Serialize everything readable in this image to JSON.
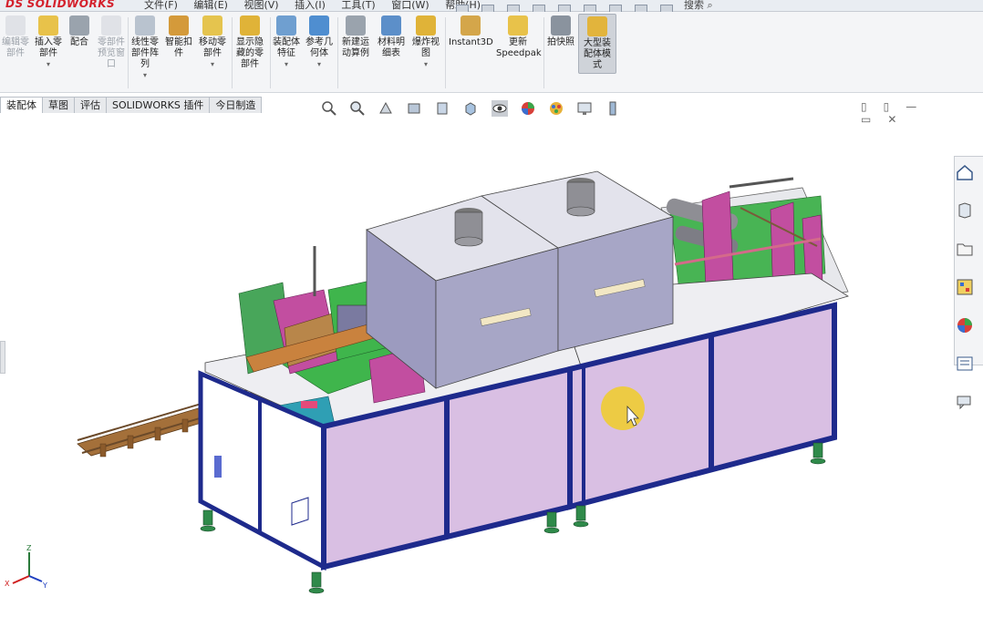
{
  "app": {
    "logo_prefix": "DS",
    "logo_text": "SOLIDWORKS"
  },
  "menu": [
    "文件(F)",
    "编辑(E)",
    "视图(V)",
    "插入(I)",
    "工具(T)",
    "窗口(W)",
    "帮助(H)"
  ],
  "search_label": "搜索",
  "ribbon": [
    {
      "label": "编辑零部件",
      "icon": "edit-component-icon",
      "enabled": false
    },
    {
      "label": "插入零部件",
      "icon": "insert-component-icon",
      "enabled": true,
      "caret": true
    },
    {
      "label": "配合",
      "icon": "mate-icon",
      "enabled": true
    },
    {
      "label": "零部件预览窗口",
      "icon": "preview-icon",
      "enabled": false
    },
    {
      "label": "线性零部件阵列",
      "icon": "pattern-icon",
      "enabled": true,
      "caret": true
    },
    {
      "label": "智能扣件",
      "icon": "smart-fastener-icon",
      "enabled": true
    },
    {
      "label": "移动零部件",
      "icon": "move-component-icon",
      "enabled": true,
      "caret": true
    },
    {
      "label": "显示隐藏的零部件",
      "icon": "show-hidden-icon",
      "enabled": true
    },
    {
      "label": "装配体特征",
      "icon": "assembly-feature-icon",
      "enabled": true,
      "caret": true
    },
    {
      "label": "参考几何体",
      "icon": "ref-geometry-icon",
      "enabled": true,
      "caret": true
    },
    {
      "label": "新建运动算例",
      "icon": "motion-study-icon",
      "enabled": true
    },
    {
      "label": "材料明细表",
      "icon": "bom-icon",
      "enabled": true
    },
    {
      "label": "爆炸视图",
      "icon": "exploded-view-icon",
      "enabled": true,
      "caret": true
    },
    {
      "label": "Instant3D",
      "icon": "instant3d-icon",
      "enabled": true
    },
    {
      "label": "更新 Speedpak",
      "icon": "speedpak-icon",
      "enabled": true
    },
    {
      "label": "拍快照",
      "icon": "snapshot-icon",
      "enabled": true
    },
    {
      "label": "大型装配体模式",
      "icon": "large-assembly-icon",
      "enabled": true,
      "active": true
    }
  ],
  "tabs": [
    "装配体",
    "草图",
    "评估",
    "SOLIDWORKS 插件",
    "今日制造"
  ],
  "active_tab": "装配体",
  "colors": {
    "frame": "#1e2a8c",
    "panel": "#d9bfe3",
    "housing": "#a7a6c6",
    "top": "#eeeef2",
    "green": "#38b44a",
    "rail": "#8b5a2b",
    "teal": "#2f9fb4",
    "magenta": "#b13a8f",
    "cursor_highlight": "#f0cd28"
  },
  "axis_labels": {
    "x": "X",
    "y": "Y",
    "z": "Z"
  }
}
